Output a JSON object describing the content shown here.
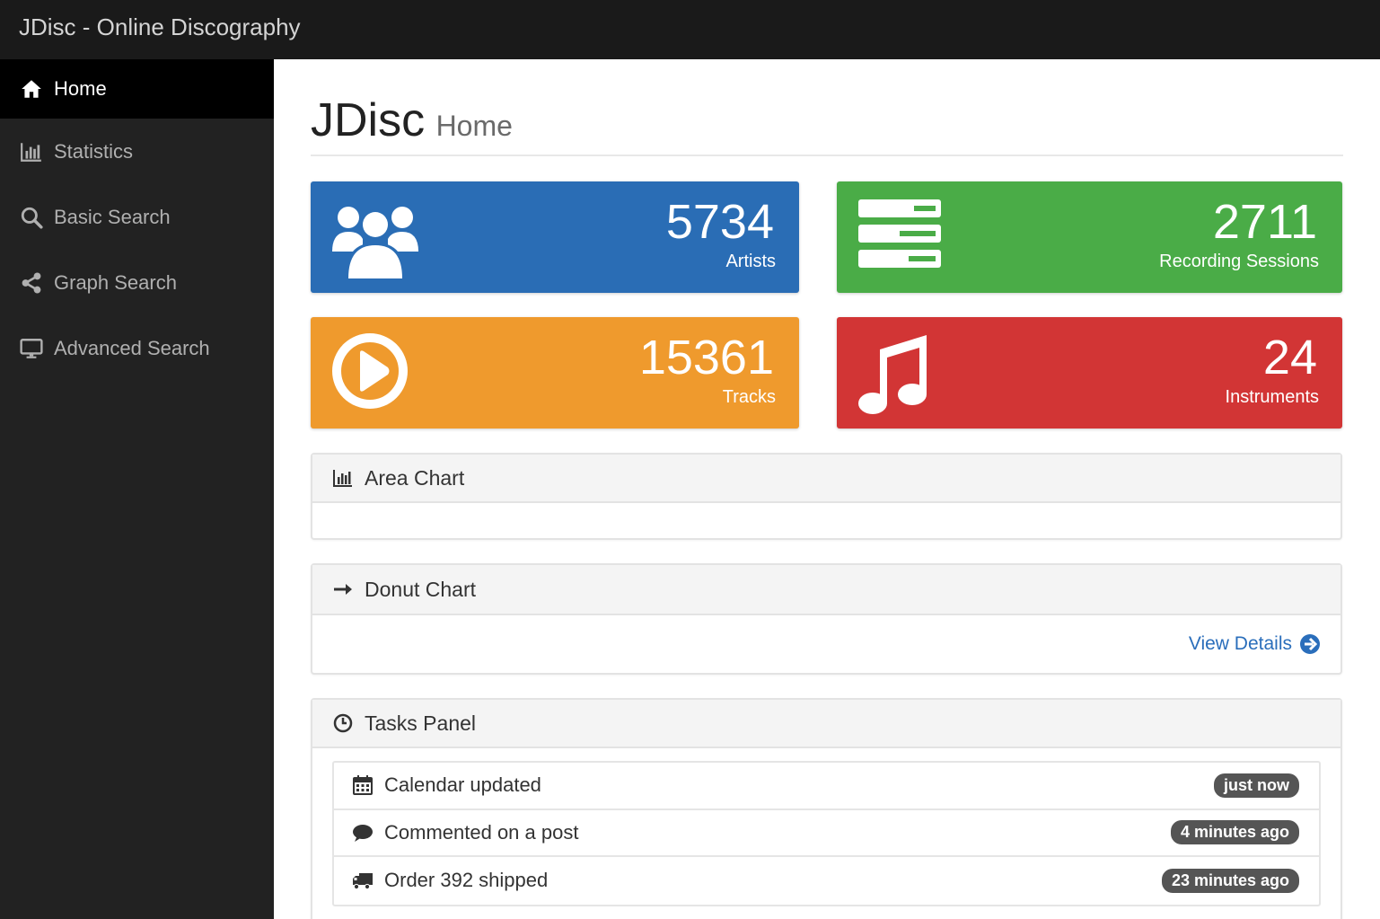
{
  "app": {
    "title": "JDisc - Online Discography"
  },
  "sidebar": {
    "items": [
      {
        "label": "Home",
        "icon": "home-icon",
        "active": true
      },
      {
        "label": "Statistics",
        "icon": "bar-chart-icon",
        "active": false
      },
      {
        "label": "Basic Search",
        "icon": "search-icon",
        "active": false
      },
      {
        "label": "Graph Search",
        "icon": "share-icon",
        "active": false
      },
      {
        "label": "Advanced Search",
        "icon": "desktop-icon",
        "active": false
      }
    ]
  },
  "header": {
    "title": "JDisc",
    "subtitle": "Home"
  },
  "stats": [
    {
      "value": "5734",
      "label": "Artists",
      "icon": "users-icon",
      "color": "#2a6db5"
    },
    {
      "value": "2711",
      "label": "Recording Sessions",
      "icon": "tasks-icon",
      "color": "#4aac47"
    },
    {
      "value": "15361",
      "label": "Tracks",
      "icon": "play-circle-icon",
      "color": "#ef9a2d"
    },
    {
      "value": "24",
      "label": "Instruments",
      "icon": "music-icon",
      "color": "#d23535"
    }
  ],
  "panels": {
    "area_chart": {
      "title": "Area Chart",
      "icon": "bar-chart-icon"
    },
    "donut_chart": {
      "title": "Donut Chart",
      "icon": "arrow-right-icon",
      "link": "View Details",
      "link_icon": "circle-arrow-right-icon"
    },
    "tasks": {
      "title": "Tasks Panel",
      "icon": "clock-icon",
      "items": [
        {
          "text": "Calendar updated",
          "icon": "calendar-icon",
          "time": "just now"
        },
        {
          "text": "Commented on a post",
          "icon": "comment-icon",
          "time": "4 minutes ago"
        },
        {
          "text": "Order 392 shipped",
          "icon": "truck-icon",
          "time": "23 minutes ago"
        }
      ]
    }
  }
}
